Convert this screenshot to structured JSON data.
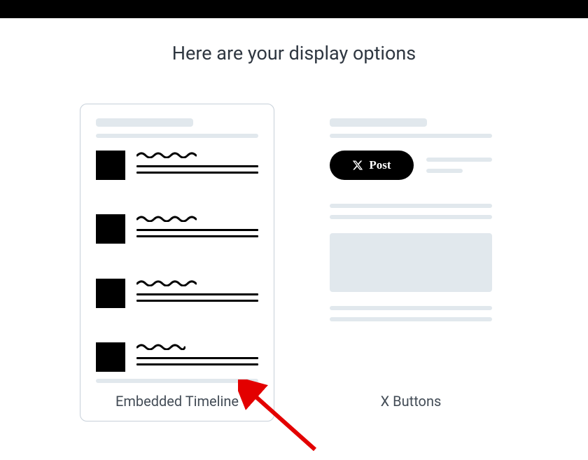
{
  "heading": "Here are your display options",
  "options": {
    "timeline": {
      "label": "Embedded Timeline"
    },
    "xbuttons": {
      "label": "X Buttons",
      "post_button_label": "Post"
    }
  }
}
